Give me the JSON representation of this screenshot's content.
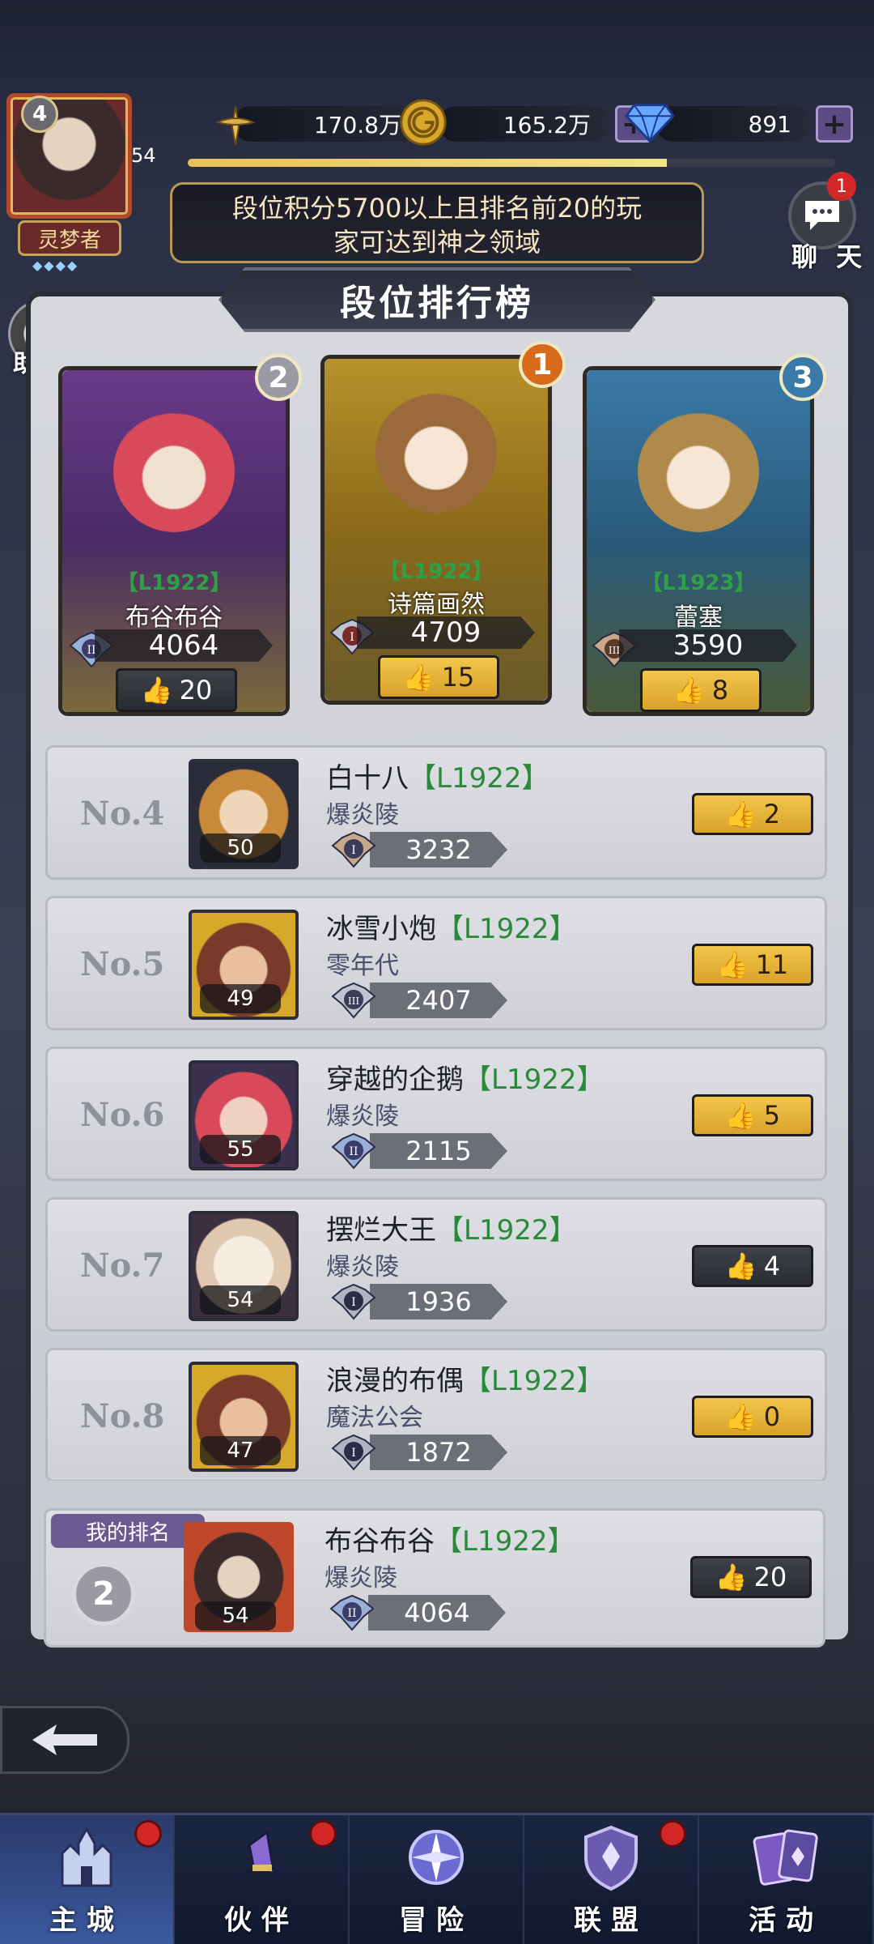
{
  "player": {
    "avatar_level": "4",
    "title": "灵梦者",
    "stars": "◆◆◆◆",
    "level": "54",
    "xp_progress": 0.74
  },
  "resources": {
    "attack_power": "170.8万",
    "gold": "165.2万",
    "diamonds": "891"
  },
  "notice": {
    "line1": "段位积分5700以上且排名前20的玩",
    "line2": "家可达到神之领域"
  },
  "chat": {
    "label": "聊 天",
    "badge": "1"
  },
  "helper": {
    "label": "助手"
  },
  "leaderboard": {
    "title": "段位排行榜",
    "top3": [
      {
        "rank": "2",
        "code": "【L1922】",
        "name": "布谷布谷",
        "score": "4064",
        "rank_tier": "II",
        "likes": "20",
        "like_style": "dark"
      },
      {
        "rank": "1",
        "code": "【L1922】",
        "name": "诗篇画然",
        "score": "4709",
        "rank_tier": "I",
        "likes": "15",
        "like_style": "gold"
      },
      {
        "rank": "3",
        "code": "【L1923】",
        "name": "蕾塞",
        "score": "3590",
        "rank_tier": "III",
        "likes": "8",
        "like_style": "gold"
      }
    ],
    "rows": [
      {
        "no": "No.4",
        "name": "白十八",
        "code": "【L1922】",
        "guild": "爆炎陵",
        "level": "50",
        "score": "3232",
        "rank_tier": "I",
        "likes": "2",
        "like_style": "gold"
      },
      {
        "no": "No.5",
        "name": "冰雪小炮",
        "code": "【L1922】",
        "guild": "零年代",
        "level": "49",
        "score": "2407",
        "rank_tier": "III",
        "likes": "11",
        "like_style": "gold"
      },
      {
        "no": "No.6",
        "name": "穿越的企鹅",
        "code": "【L1922】",
        "guild": "爆炎陵",
        "level": "55",
        "score": "2115",
        "rank_tier": "II",
        "likes": "5",
        "like_style": "gold"
      },
      {
        "no": "No.7",
        "name": "摆烂大王",
        "code": "【L1922】",
        "guild": "爆炎陵",
        "level": "54",
        "score": "1936",
        "rank_tier": "I",
        "likes": "4",
        "like_style": "dark"
      },
      {
        "no": "No.8",
        "name": "浪漫的布偶",
        "code": "【L1922】",
        "guild": "魔法公会",
        "level": "47",
        "score": "1872",
        "rank_tier": "I",
        "likes": "0",
        "like_style": "gold"
      }
    ],
    "my_rank": {
      "tag": "我的排名",
      "rank": "2",
      "name": "布谷布谷",
      "code": "【L1922】",
      "guild": "爆炎陵",
      "level": "54",
      "score": "4064",
      "rank_tier": "II",
      "likes": "20"
    }
  },
  "nav": [
    {
      "label": "主城",
      "icon": "castle-icon",
      "active": true,
      "dot": true
    },
    {
      "label": "伙伴",
      "icon": "witch-hat-icon",
      "active": false,
      "dot": true
    },
    {
      "label": "冒险",
      "icon": "compass-icon",
      "active": false,
      "dot": false
    },
    {
      "label": "联盟",
      "icon": "shield-icon",
      "active": false,
      "dot": true
    },
    {
      "label": "活动",
      "icon": "cards-icon",
      "active": false,
      "dot": false
    }
  ],
  "colors": {
    "gold_button": "#f2c64a",
    "dark_button": "#2a2c33",
    "code_green": "#2a8a3a",
    "badge_red": "#d42828"
  }
}
